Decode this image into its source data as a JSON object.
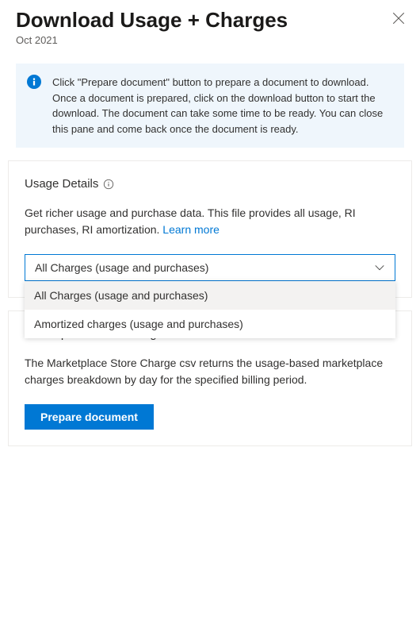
{
  "header": {
    "title": "Download Usage + Charges",
    "subtitle": "Oct 2021"
  },
  "info": {
    "text": "Click \"Prepare document\" button to prepare a document to download. Once a document is prepared, click on the download button to start the download. The document can take some time to be ready. You can close this pane and come back once the document is ready."
  },
  "usage": {
    "title": "Usage Details",
    "description": "Get richer usage and purchase data. This file provides all usage, RI purchases, RI amortization. ",
    "learn_more": "Learn more",
    "dropdown_selected": "All Charges (usage and purchases)",
    "dropdown_options": [
      "All Charges (usage and purchases)",
      "Amortized charges (usage and purchases)"
    ]
  },
  "marketplace": {
    "title": "Marketplace Store Charge",
    "description": "The Marketplace Store Charge csv returns the usage-based marketplace charges breakdown by day for the specified billing period.",
    "button_label": "Prepare document"
  }
}
